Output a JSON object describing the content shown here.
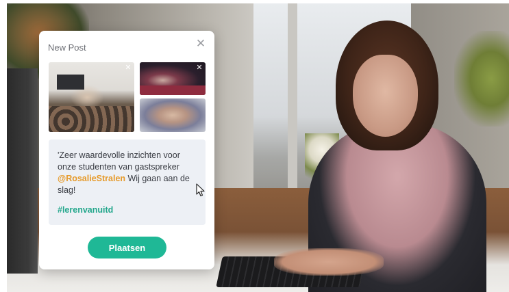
{
  "modal": {
    "title": "New Post",
    "close_icon": "close-icon",
    "photos": [
      {
        "remove_icon": "close-icon"
      },
      {
        "remove_icon": "close-icon"
      },
      {}
    ],
    "post": {
      "text_line1": "'Zeer waardevolle inzichten voor onze studenten van gastspreker",
      "mention": "@RosalieStralen",
      "text_line2": " Wij gaan aan de slag!",
      "hashtag": "#lerenvanuitd"
    },
    "publish_label": "Plaatsen"
  },
  "colors": {
    "accent": "#1fb896",
    "mention": "#e69a2a",
    "hashtag": "#23a78c",
    "text_box_bg": "#edf0f5"
  }
}
